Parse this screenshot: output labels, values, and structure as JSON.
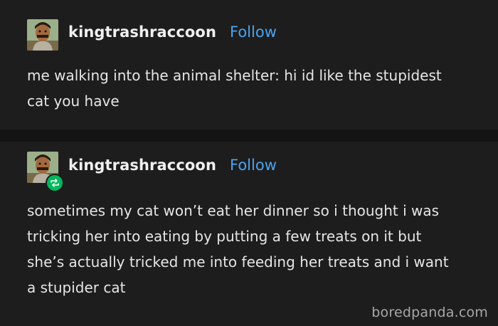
{
  "posts": [
    {
      "username": "kingtrashraccoon",
      "follow_label": "Follow",
      "text": "me walking into the animal shelter: hi id like the stupidest\ncat you have"
    },
    {
      "username": "kingtrashraccoon",
      "follow_label": "Follow",
      "text": "sometimes my cat won’t eat her dinner so i thought i was\ntricking her into eating by putting a few treats on it but\nshe’s actually tricked me into feeding her treats and i want\na stupider cat"
    }
  ],
  "watermark": "boredpanda.com",
  "colors": {
    "background": "#1d1d1d",
    "follow": "#4aa3f0",
    "reblog_badge": "#00b85c"
  },
  "icons": {
    "avatar": "avatar-icon",
    "reblog": "reblog-icon"
  }
}
